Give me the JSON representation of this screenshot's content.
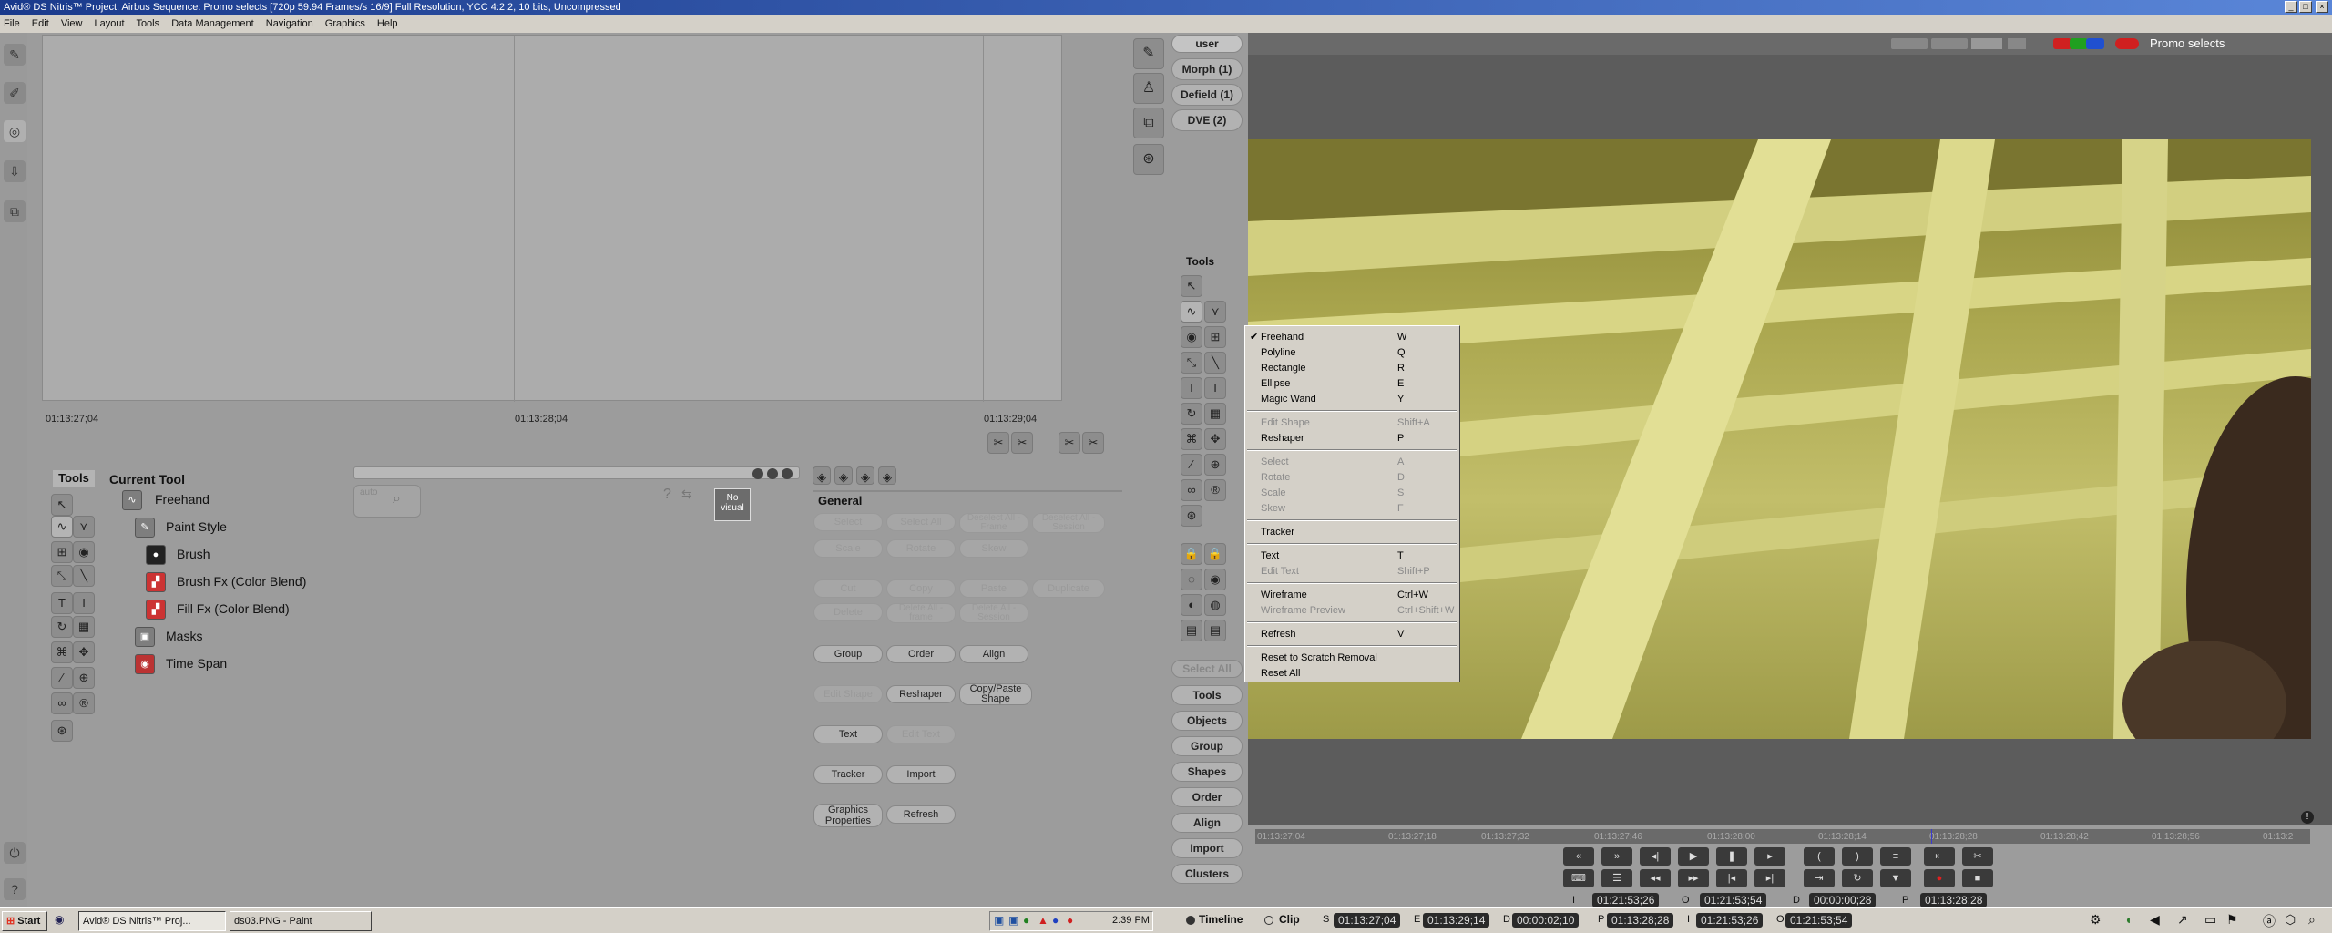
{
  "window": {
    "title": "Avid® DS Nitris™ Project: Airbus     Sequence: Promo selects     [720p 59.94 Frames/s 16/9]   Full Resolution, YCC 4:2:2, 10 bits, Uncompressed"
  },
  "menubar": {
    "items": [
      "File",
      "Edit",
      "View",
      "Layout",
      "Tools",
      "Data Management",
      "Navigation",
      "Graphics",
      "Help"
    ]
  },
  "timeline": {
    "tc1": "01:13:27;04",
    "tc2": "01:13:28;04",
    "tc3": "01:13:29;04"
  },
  "tool_tree": {
    "tab_tools": "Tools",
    "tab_current": "Current Tool",
    "items": [
      "Freehand",
      "Paint Style",
      "Brush",
      "Brush Fx (Color Blend)",
      "Fill Fx (Color Blend)",
      "Masks",
      "Time Span"
    ]
  },
  "mini": {
    "auto": "auto",
    "no_visual": "No visual"
  },
  "general": {
    "header": "General",
    "select": "Select",
    "select_all": "Select All",
    "deselect_frame": "Deselect All - Frame",
    "deselect_session": "Deselect All - Session",
    "scale": "Scale",
    "rotate": "Rotate",
    "skew": "Skew",
    "cut": "Cut",
    "copy": "Copy",
    "paste": "Paste",
    "duplicate": "Duplicate",
    "delete": "Delete",
    "delete_frame": "Delete All - frame",
    "delete_session": "Delete All - Session",
    "group": "Group",
    "order": "Order",
    "align": "Align",
    "edit_shape": "Edit Shape",
    "reshaper": "Reshaper",
    "copy_paste_shape": "Copy/Paste Shape",
    "text": "Text",
    "edit_text": "Edit Text",
    "tracker": "Tracker",
    "import": "Import",
    "graphics_properties": "Graphics Properties",
    "refresh": "Refresh"
  },
  "right_panel": {
    "user": "user",
    "morph": "Morph (1)",
    "defield": "Defield (1)",
    "dve": "DVE (2)",
    "tools_label": "Tools",
    "select_all": "Select All",
    "buttons": [
      "Tools",
      "Objects",
      "Group",
      "Shapes",
      "Order",
      "Align",
      "Import",
      "Clusters"
    ]
  },
  "viewer": {
    "name": "Promo selects"
  },
  "context_menu": {
    "items": [
      {
        "label": "Freehand",
        "shortcut": "W",
        "checked": true,
        "disabled": false
      },
      {
        "label": "Polyline",
        "shortcut": "Q",
        "disabled": false
      },
      {
        "label": "Rectangle",
        "shortcut": "R",
        "disabled": false
      },
      {
        "label": "Ellipse",
        "shortcut": "E",
        "disabled": false
      },
      {
        "label": "Magic Wand",
        "shortcut": "Y",
        "disabled": false
      },
      {
        "label": "Edit Shape",
        "shortcut": "Shift+A",
        "disabled": true
      },
      {
        "label": "Reshaper",
        "shortcut": "P",
        "disabled": false
      },
      {
        "label": "Select",
        "shortcut": "A",
        "disabled": true
      },
      {
        "label": "Rotate",
        "shortcut": "D",
        "disabled": true
      },
      {
        "label": "Scale",
        "shortcut": "S",
        "disabled": true
      },
      {
        "label": "Skew",
        "shortcut": "F",
        "disabled": true
      },
      {
        "label": "Tracker",
        "shortcut": "",
        "disabled": false
      },
      {
        "label": "Text",
        "shortcut": "T",
        "disabled": false
      },
      {
        "label": "Edit Text",
        "shortcut": "Shift+P",
        "disabled": true
      },
      {
        "label": "Wireframe",
        "shortcut": "Ctrl+W",
        "disabled": false
      },
      {
        "label": "Wireframe Preview",
        "shortcut": "Ctrl+Shift+W",
        "disabled": true
      },
      {
        "label": "Refresh",
        "shortcut": "V",
        "disabled": false
      },
      {
        "label": "Reset to Scratch Removal",
        "shortcut": "",
        "disabled": false
      },
      {
        "label": "Reset All",
        "shortcut": "",
        "disabled": false
      }
    ]
  },
  "ruler": {
    "ticks": [
      "01:13:27;04",
      "01:13:27;18",
      "01:13:27;32",
      "01:13:27;46",
      "01:13:28;00",
      "01:13:28;14",
      "01:13:28;28",
      "01:13:28;42",
      "01:13:28;56",
      "01:13:2"
    ]
  },
  "transport": {
    "in_label": "I",
    "in_tc": "01:21:53;26",
    "out_label": "O",
    "out_tc": "01:21:53;54",
    "dur_label": "D",
    "dur_tc": "00:00:00;28",
    "pos_label": "P",
    "pos_tc": "01:13:28;28"
  },
  "status_row": {
    "timeline": "Timeline",
    "clip": "Clip",
    "s_label": "S",
    "s_tc": "01:13:27;04",
    "e_label": "E",
    "e_tc": "01:13:29;14",
    "d_label": "D",
    "d_tc": "00:00:02;10",
    "p_label": "P",
    "p_tc": "01:13:28;28",
    "i_label": "I",
    "i_tc": "01:21:53;26",
    "o_label": "O",
    "o_tc": "01:21:53;54"
  },
  "taskbar": {
    "start": "Start",
    "tasks": [
      "Avid® DS Nitris™ Proj...",
      "ds03.PNG - Paint"
    ],
    "clock": "2:39 PM"
  }
}
